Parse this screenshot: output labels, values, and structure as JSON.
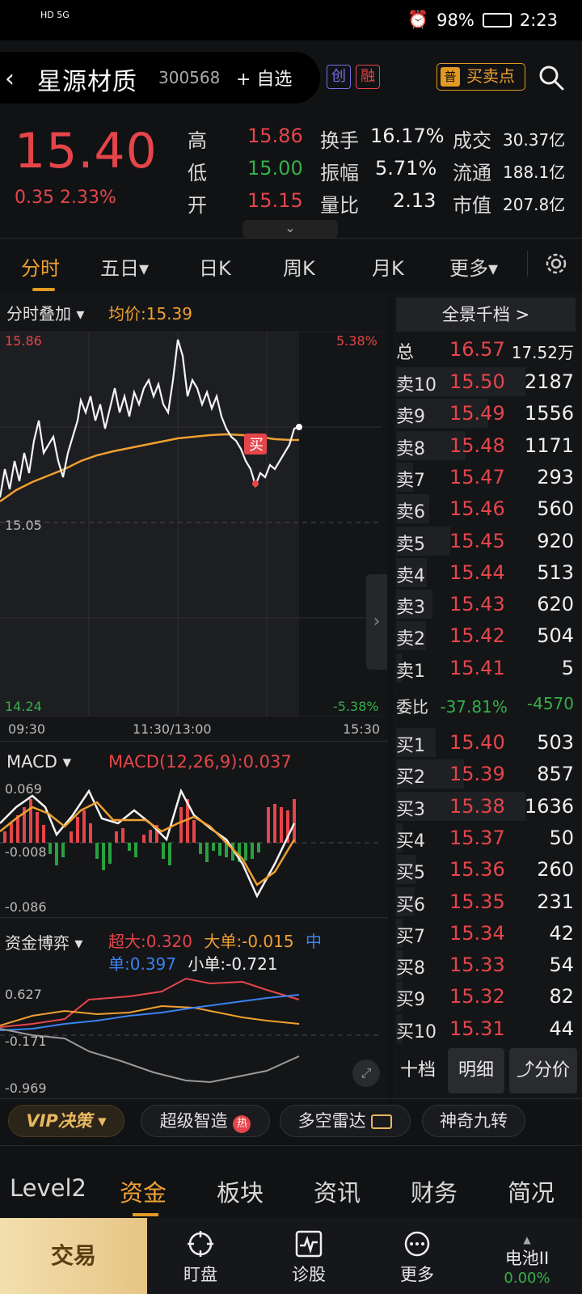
{
  "status": {
    "network": "HD 5G",
    "battery": "98%",
    "time": "2:23"
  },
  "header": {
    "back": "‹",
    "name": "星源材质",
    "code": "300568",
    "add_fav": "+ 自选",
    "tag1": "创",
    "tag2": "融",
    "bsp_icon": "普",
    "bsp": "买卖点"
  },
  "quote": {
    "price": "15.40",
    "change": "0.35 2.33%",
    "high_label": "高",
    "high": "15.86",
    "low_label": "低",
    "low": "15.00",
    "open_label": "开",
    "open": "15.15",
    "turnover_label": "换手",
    "turnover": "16.17%",
    "amplitude_label": "振幅",
    "amplitude": "5.71%",
    "vol_ratio_label": "量比",
    "vol_ratio": "2.13",
    "amount_label": "成交",
    "amount": "30.37亿",
    "float_label": "流通",
    "float_cap": "188.1亿",
    "mcap_label": "市值",
    "mcap": "207.8亿",
    "expand": "⌄"
  },
  "tabs": [
    "分时",
    "五日▾",
    "日K",
    "周K",
    "月K",
    "更多▾"
  ],
  "chart": {
    "overlay_label": "分时叠加 ▾",
    "avg_price": "均价:15.39",
    "y_top": "15.86",
    "y_mid": "15.05",
    "y_bottom": "14.24",
    "pct_top": "5.38%",
    "pct_bottom": "-5.38%",
    "x_start": "09:30",
    "x_mid": "11:30/13:00",
    "x_end": "15:30",
    "buy_marker": "买",
    "macd_label": "MACD ▾",
    "macd_value": "MACD(12,26,9):0.037",
    "macd_ticks": [
      "0.069",
      "-0.008",
      "-0.086"
    ],
    "fund_label": "资金博弈 ▾",
    "fund_super": "超大:0.320",
    "fund_large": "大单:-0.015",
    "fund_mid": "中单:0.397",
    "fund_small": "小单:-0.721",
    "fund_ticks": [
      "0.627",
      "-0.171",
      "-0.969"
    ],
    "fund_colors": {
      "super": "#e5454a",
      "large": "#f0a030",
      "mid": "#3a82f0",
      "small": "#b8b8b8"
    }
  },
  "order_book": {
    "title": "全景千档 >",
    "total_label": "总",
    "total_price": "16.57",
    "total_vol": "17.52万",
    "asks": [
      {
        "label": "卖10",
        "price": "15.50",
        "vol": "2187"
      },
      {
        "label": "卖9",
        "price": "15.49",
        "vol": "1556"
      },
      {
        "label": "卖8",
        "price": "15.48",
        "vol": "1171"
      },
      {
        "label": "卖7",
        "price": "15.47",
        "vol": "293"
      },
      {
        "label": "卖6",
        "price": "15.46",
        "vol": "560"
      },
      {
        "label": "卖5",
        "price": "15.45",
        "vol": "920"
      },
      {
        "label": "卖4",
        "price": "15.44",
        "vol": "513"
      },
      {
        "label": "卖3",
        "price": "15.43",
        "vol": "620"
      },
      {
        "label": "卖2",
        "price": "15.42",
        "vol": "504"
      },
      {
        "label": "卖1",
        "price": "15.41",
        "vol": "5"
      }
    ],
    "webi_label": "委比",
    "webi_pct": "-37.81%",
    "webi_diff": "-4570",
    "bids": [
      {
        "label": "买1",
        "price": "15.40",
        "vol": "503"
      },
      {
        "label": "买2",
        "price": "15.39",
        "vol": "857"
      },
      {
        "label": "买3",
        "price": "15.38",
        "vol": "1636"
      },
      {
        "label": "买4",
        "price": "15.37",
        "vol": "50"
      },
      {
        "label": "买5",
        "price": "15.36",
        "vol": "260"
      },
      {
        "label": "买6",
        "price": "15.35",
        "vol": "231"
      },
      {
        "label": "买7",
        "price": "15.34",
        "vol": "42"
      },
      {
        "label": "买8",
        "price": "15.33",
        "vol": "54"
      },
      {
        "label": "买9",
        "price": "15.32",
        "vol": "82"
      },
      {
        "label": "买10",
        "price": "15.31",
        "vol": "44"
      }
    ],
    "btn_ten": "十档",
    "btn_detail": "明细",
    "btn_price": "分价"
  },
  "chips": {
    "vip": "VIP决策 ▾",
    "super": "超级智造",
    "hot": "热",
    "radar": "多空雷达",
    "nine": "神奇九转"
  },
  "bottom_tabs": [
    "Level2",
    "资金",
    "板块",
    "资讯",
    "财务",
    "简况"
  ],
  "nav": {
    "trade": "交易",
    "watch": "盯盘",
    "diag": "诊股",
    "more": "更多",
    "battery_name": "电池II",
    "battery_pct": "0.00%"
  }
}
